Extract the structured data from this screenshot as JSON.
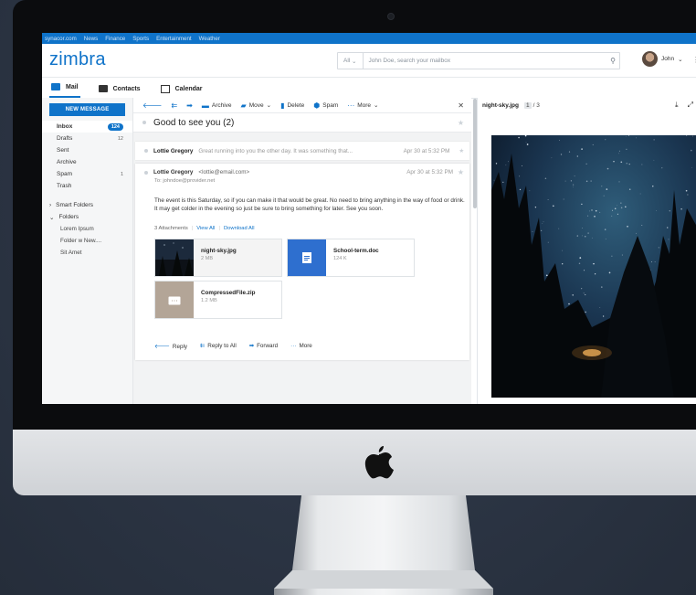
{
  "topbar": {
    "links": [
      "synacor.com",
      "News",
      "Finance",
      "Sports",
      "Entertainment",
      "Weather"
    ]
  },
  "header": {
    "logo": "zimbra",
    "search_scope": "All",
    "search_placeholder": "John Doe, search your mailbox",
    "user_name": "John"
  },
  "tabs": [
    {
      "label": "Mail",
      "active": true
    },
    {
      "label": "Contacts",
      "active": false
    },
    {
      "label": "Calendar",
      "active": false
    }
  ],
  "sidebar": {
    "new_message": "NEW MESSAGE",
    "folders": [
      {
        "label": "Inbox",
        "count": "124",
        "badge": true
      },
      {
        "label": "Drafts",
        "count": "12",
        "badge": false
      },
      {
        "label": "Sent",
        "count": "",
        "badge": false
      },
      {
        "label": "Archive",
        "count": "",
        "badge": false
      },
      {
        "label": "Spam",
        "count": "1",
        "badge": false
      },
      {
        "label": "Trash",
        "count": "",
        "badge": false
      }
    ],
    "smart_folders": "Smart Folders",
    "folders_label": "Folders",
    "sub_folders": [
      "Lorem Ipsum",
      "Folder w New....",
      "Sit Amet"
    ]
  },
  "toolbar": {
    "archive": "Archive",
    "move": "Move",
    "delete": "Delete",
    "spam": "Spam",
    "more": "More"
  },
  "conversation": {
    "subject": "Good to see you (2)",
    "messages": [
      {
        "sender": "Lottie Gregory",
        "snippet": "Great running into you the other day. It was something that...",
        "date": "Apr 30 at 5:32 PM"
      }
    ],
    "open": {
      "sender": "Lottie Gregory",
      "email": "<lottie@email.com>",
      "to": "To: johndoe@provider.net",
      "date": "Apr 30 at 5:32 PM",
      "body": "The event is this Saturday, so if you can make it that would be great. No need to bring anything in the way of food or drink. It may get colder in the evening so just be sure to bring something for later. See you soon.",
      "attachments_label": "3 Attachments",
      "view_all": "View All",
      "download_all": "Download All",
      "attachments": [
        {
          "name": "night-sky.jpg",
          "size": "2 MB"
        },
        {
          "name": "School-term.doc",
          "size": "124 K"
        },
        {
          "name": "CompressedFile.zip",
          "size": "1.2 MB"
        }
      ],
      "actions": {
        "reply": "Reply",
        "reply_all": "Reply to All",
        "forward": "Forward",
        "more": "More"
      }
    }
  },
  "preview": {
    "filename": "night-sky.jpg",
    "page_current": "1",
    "page_total": "/ 3"
  },
  "colors": {
    "brand": "#0f73c9",
    "bezel": "#0b0c0e",
    "chin": "#d9dbde",
    "background": "#2a3444"
  }
}
